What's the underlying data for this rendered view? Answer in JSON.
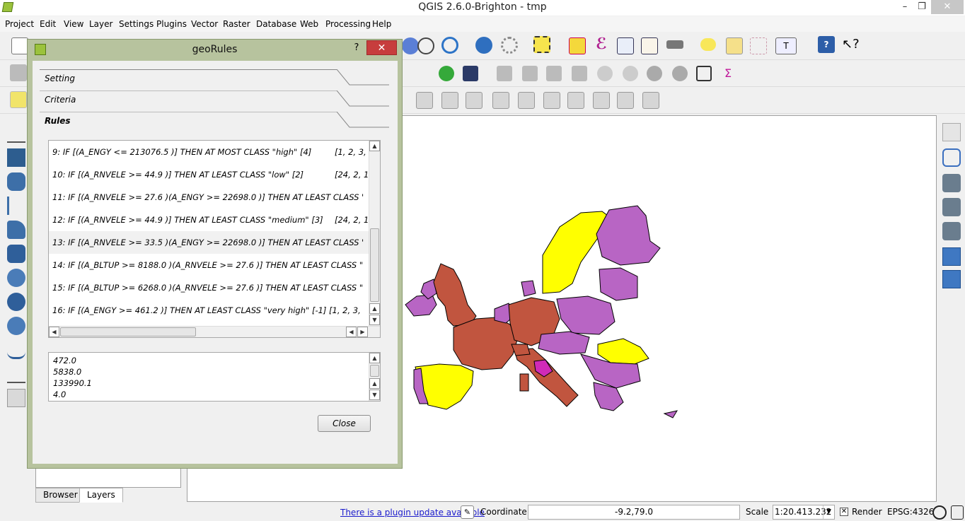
{
  "window": {
    "title": "QGIS 2.6.0-Brighton - tmp",
    "minimize": "–",
    "maximize": "❐",
    "close": "✕"
  },
  "menu": [
    "Project",
    "Edit",
    "View",
    "Layer",
    "Settings",
    "Plugins",
    "Vector",
    "Raster",
    "Database",
    "Web",
    "Processing",
    "Help"
  ],
  "dialog": {
    "title": "geoRules",
    "help": "?",
    "close_x": "✕",
    "sections": [
      "Setting",
      "Criteria",
      "Rules"
    ],
    "rules": [
      {
        "text": "9: IF [(A_ENGY <= 213076.5 )] THEN AT MOST CLASS \"high\" [4]",
        "classes": "[1, 2, 3,"
      },
      {
        "text": "10: IF [(A_RNVELE >= 44.9 )] THEN AT LEAST CLASS \"low\" [2]",
        "classes": "[24, 2, 1"
      },
      {
        "text": "11: IF [(A_RNVELE >= 27.6 )(A_ENGY >= 22698.0 )] THEN AT LEAST CLASS '",
        "classes": ""
      },
      {
        "text": "12: IF [(A_RNVELE >= 44.9 )] THEN AT LEAST CLASS \"medium\" [3]",
        "classes": "[24, 2, 1"
      },
      {
        "text": "13: IF [(A_RNVELE >= 33.5 )(A_ENGY >= 22698.0 )] THEN AT LEAST CLASS '",
        "classes": ""
      },
      {
        "text": "14: IF [(A_BLTUP >= 8188.0 )(A_RNVELE >= 27.6 )] THEN AT LEAST CLASS \"",
        "classes": ""
      },
      {
        "text": "15: IF [(A_BLTUP >= 6268.0 )(A_RNVELE >= 27.6 )] THEN AT LEAST CLASS \"",
        "classes": ""
      },
      {
        "text": "16: IF [(A_ENGY >= 461.2 )] THEN AT LEAST CLASS \"very high\" [-1] [1, 2, 3,",
        "classes": ""
      }
    ],
    "values": [
      "472.0",
      "5838.0",
      "133990.1",
      "4.0"
    ],
    "close_button": "Close"
  },
  "panel_tabs": [
    "Browser",
    "Layers"
  ],
  "status": {
    "plugin_update": "There is a plugin update available",
    "coordinate_label": "Coordinate:",
    "coordinate_value": "-9.2,79.0",
    "scale_label": "Scale",
    "scale_value": "1:20.413.232",
    "render_label": "Render",
    "epsg": "EPSG:4326"
  },
  "map_colors": {
    "yellow": "#ffff00",
    "purple": "#b865c4",
    "brown": "#c1553f",
    "magenta": "#d02ab8"
  }
}
